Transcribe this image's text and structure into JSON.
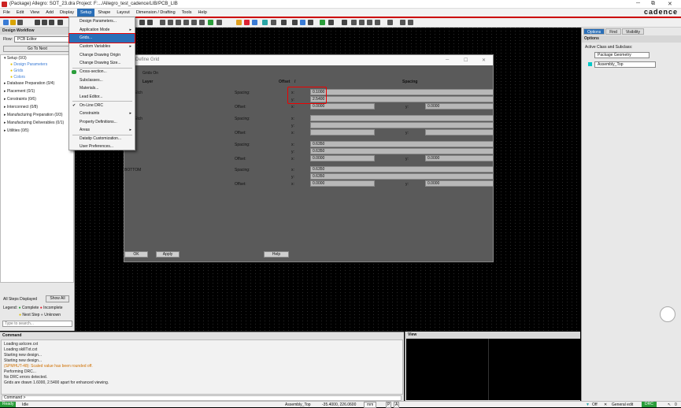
{
  "titlebar": {
    "title": "(Package) Allegro: SOT_23.dra  Project: F:.../Allegro_test_cadence/LIB/PCB_LIB",
    "minimize": "─",
    "restore": "⧉",
    "close": "✕",
    "brand": "cadence"
  },
  "menu": [
    "File",
    "Edit",
    "View",
    "Add",
    "Display",
    "Setup",
    "Shape",
    "Layout",
    "Dimension / Drafting",
    "Tools",
    "Help"
  ],
  "setup_menu": {
    "items": [
      {
        "label": "Design Parameters...",
        "arrow": ""
      },
      {
        "label": "Grids...",
        "arrow": "",
        "highlight": true
      },
      {
        "label": "Application Mode",
        "arrow": "▸"
      },
      {
        "label": "Custom Variables",
        "arrow": "▸"
      },
      {
        "label": "Change Drawing Origin",
        "arrow": ""
      },
      {
        "label": "Change Drawing Size...",
        "arrow": ""
      },
      {
        "label": "Cross-section...",
        "arrow": ""
      },
      {
        "label": "Subclasses...",
        "arrow": ""
      },
      {
        "label": "Materials...",
        "arrow": ""
      },
      {
        "label": "Lead Editor...",
        "arrow": ""
      },
      {
        "label": "On-Line DRC",
        "arrow": "",
        "check": "✔"
      },
      {
        "label": "Constraints",
        "arrow": "▸"
      },
      {
        "label": "Property Definitions...",
        "arrow": ""
      },
      {
        "label": "Areas",
        "arrow": "▸"
      },
      {
        "label": "Datatip Customization...",
        "arrow": ""
      },
      {
        "label": "User Preferences...",
        "arrow": ""
      }
    ]
  },
  "workflow": {
    "header": "Design Workflow",
    "flow_label": "Flow:",
    "flow_value": "PCB Editor",
    "go_next": "Go To Next",
    "items": [
      "Setup (0/3)",
      "Design Parameters",
      "Grids",
      "Colors",
      "Database Preparation (0/4)",
      "Placement (0/1)",
      "Constraints (0/6)",
      "Interconnect (0/8)",
      "Manufacturing Preparation (0/3)",
      "Manufacturing Deliverables (0/1)",
      "Utilities (0/5)"
    ],
    "all_steps": "All Steps Displayed",
    "show_all": "Show All",
    "legend": "Legend:",
    "complete": "Complete",
    "incomplete": "Incomplete",
    "next_step": "Next Step",
    "unknown": "Unknown",
    "search_placeholder": "Type to search..."
  },
  "define_grid": {
    "title": "Define Grid",
    "grids_on": "Grids On",
    "col_layer": "Layer",
    "col_offset": "Offset",
    "col_offset_slash": "/",
    "col_spacing": "Spacing",
    "rows": [
      {
        "layer": "Etch",
        "spacing_x": "0.1000",
        "spacing_y": "2.5400",
        "offset_x": "0.0000",
        "offset_y": "0.0000"
      },
      {
        "layer": "Etch",
        "spacing_x": "",
        "spacing_y": "",
        "offset_x": "",
        "offset_y": ""
      },
      {
        "layer": "",
        "spacing_x": "0.6350",
        "spacing_y": "0.6350",
        "offset_x": "0.0000",
        "offset_y": "0.0000"
      },
      {
        "layer": "BOTTOM",
        "spacing_x": "0.6350",
        "spacing_y": "0.6350",
        "offset_x": "0.0000",
        "offset_y": "0.0000"
      }
    ],
    "labels": {
      "spacing": "Spacing:",
      "offset": "Offset:",
      "x": "x:",
      "y": "y:"
    },
    "ok": "OK",
    "apply": "Apply",
    "help": "Help",
    "minimize": "─",
    "maximize": "☐",
    "close": "✕"
  },
  "options": {
    "tabs": [
      "Options",
      "Find",
      "Visibility"
    ],
    "header": "Options",
    "active_class_label": "Active Class and Subclass:",
    "class_value": "Package Geometry",
    "subclass_value": "Assembly_Top",
    "subclass_color": "#00c8c8"
  },
  "command": {
    "header": "Command",
    "lines": [
      "Loading axlcore.cxt",
      "Loading skillTxt.cxt",
      "Starting new design...",
      "Starting new design...",
      "(SPMHUT-48): Scaled value has been rounded off.",
      "Performing DRC...",
      "No DRC errors detected.",
      "Grids are drawn 1.6000, 2.5400 apart for enhanced viewing."
    ],
    "prompt": "Command >"
  },
  "view": {
    "header": "View"
  },
  "status": {
    "ready": "Ready",
    "idle": "Idle",
    "subclass": "Assembly_Top",
    "coords": "-35.4000, 226.0600",
    "units": "mm",
    "p": "P",
    "a": "A",
    "off": "Off",
    "mode": "General edit",
    "drc": "DRC",
    "count": "0"
  }
}
